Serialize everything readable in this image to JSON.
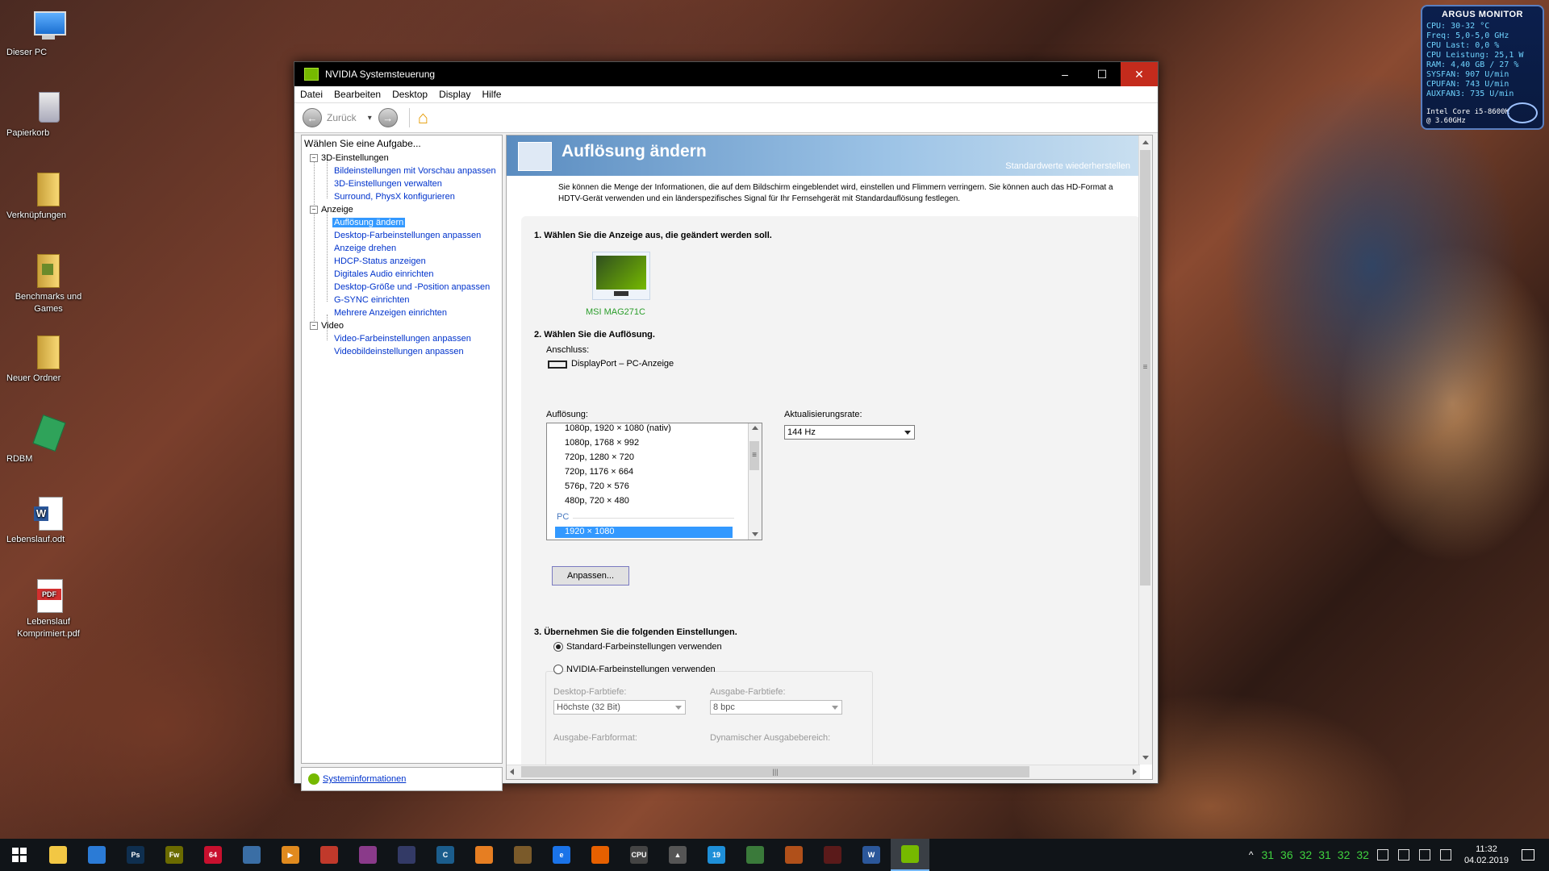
{
  "desktop": {
    "icons": [
      {
        "label": "Dieser PC"
      },
      {
        "label": "Papierkorb"
      },
      {
        "label": "Verknüpfungen"
      },
      {
        "label": "Benchmarks und Games"
      },
      {
        "label": "Neuer Ordner"
      },
      {
        "label": "RDBM"
      },
      {
        "label": "Lebenslauf.odt"
      },
      {
        "label": "Lebenslauf Komprimiert.pdf"
      }
    ],
    "pdf_badge": "PDF"
  },
  "argus": {
    "title": "ARGUS MONITOR",
    "lines": [
      "CPU: 30-32 °C",
      "Freq: 5,0-5,0 GHz",
      "CPU Last: 0,0 %",
      "CPU Leistung: 25,1 W",
      "RAM: 4,40 GB / 27 %",
      "SYSFAN: 907 U/min",
      "CPUFAN: 743 U/min",
      "AUXFAN3: 735 U/min"
    ],
    "footer1": "Intel Core i5-8600K",
    "footer2": "@ 3.60GHz"
  },
  "window": {
    "title": "NVIDIA Systemsteuerung",
    "controls": {
      "minimize": "‒",
      "maximize": "☐",
      "close": "✕"
    },
    "menu": [
      "Datei",
      "Bearbeiten",
      "Desktop",
      "Display",
      "Hilfe"
    ],
    "toolbar": {
      "back_label": "Zurück",
      "back_glyph": "←",
      "fwd_glyph": "→",
      "home_glyph": "⌂",
      "dropdown_glyph": "▾"
    },
    "left": {
      "header": "Wählen Sie eine Aufgabe...",
      "categories": [
        {
          "label": "3D-Einstellungen",
          "items": [
            "Bildeinstellungen mit Vorschau anpassen",
            "3D-Einstellungen verwalten",
            "Surround, PhysX konfigurieren"
          ]
        },
        {
          "label": "Anzeige",
          "items": [
            "Auflösung ändern",
            "Desktop-Farbeinstellungen anpassen",
            "Anzeige drehen",
            "HDCP-Status anzeigen",
            "Digitales Audio einrichten",
            "Desktop-Größe und -Position anpassen",
            "G-SYNC einrichten",
            "Mehrere Anzeigen einrichten"
          ]
        },
        {
          "label": "Video",
          "items": [
            "Video-Farbeinstellungen anpassen",
            "Videobildeinstellungen anpassen"
          ]
        }
      ],
      "expander": "−",
      "sysinfo": "Systeminformationen"
    },
    "main": {
      "title": "Auflösung ändern",
      "restore": "Standardwerte wiederherstellen",
      "description": "Sie können die Menge der Informationen, die auf dem Bildschirm eingeblendet wird, einstellen und Flimmern verringern. Sie können auch das HD-Format a HDTV-Gerät verwenden und ein länderspezifisches Signal für Ihr Fernsehgerät mit Standardauflösung festlegen.",
      "step1": "1. Wählen Sie die Anzeige aus, die geändert werden soll.",
      "monitor_name": "MSI MAG271C",
      "step2": "2. Wählen Sie die Auflösung.",
      "connection_label": "Anschluss:",
      "connection_value": "DisplayPort – PC-Anzeige",
      "resolution_label": "Auflösung:",
      "resolutions": [
        "1080p, 1920 × 1080 (nativ)",
        "1080p, 1768 × 992",
        "720p, 1280 × 720",
        "720p, 1176 × 664",
        "576p, 720 × 576",
        "480p, 720 × 480"
      ],
      "pc_group": "PC",
      "selected_resolution": "1920 × 1080",
      "refresh_label": "Aktualisierungsrate:",
      "refresh_value": "144 Hz",
      "customize_button": "Anpassen...",
      "step3": "3. Übernehmen Sie die folgenden Einstellungen.",
      "radio_default": "Standard-Farbeinstellungen verwenden",
      "radio_nvidia": "NVIDIA-Farbeinstellungen verwenden",
      "desktop_depth_label": "Desktop-Farbtiefe:",
      "desktop_depth_value": "Höchste (32 Bit)",
      "output_depth_label": "Ausgabe-Farbtiefe:",
      "output_depth_value": "8 bpc",
      "output_format_label": "Ausgabe-Farbformat:",
      "dynamic_range_label": "Dynamischer Ausgabebereich:",
      "scroll_grip": "≡",
      "hscroll_grip": "|||"
    }
  },
  "taskbar": {
    "apps": [
      {
        "name": "explorer",
        "color": "#f2c744",
        "text": ""
      },
      {
        "name": "app-blue",
        "color": "#2b7bd6",
        "text": ""
      },
      {
        "name": "photoshop",
        "color": "#0f2f4f",
        "text": "Ps"
      },
      {
        "name": "fireworks",
        "color": "#6b6b00",
        "text": "Fw"
      },
      {
        "name": "aida64",
        "color": "#c8102e",
        "text": "64"
      },
      {
        "name": "app-calc",
        "color": "#3a6ea5",
        "text": ""
      },
      {
        "name": "player",
        "color": "#e08a1e",
        "text": "▶"
      },
      {
        "name": "app-red",
        "color": "#c0392b",
        "text": ""
      },
      {
        "name": "winrar",
        "color": "#8a3a8a",
        "text": ""
      },
      {
        "name": "cinema",
        "color": "#333a66",
        "text": ""
      },
      {
        "name": "app-c",
        "color": "#1b5d8c",
        "text": "C"
      },
      {
        "name": "app-orange",
        "color": "#e67e22",
        "text": ""
      },
      {
        "name": "app-doc",
        "color": "#7a5a2a",
        "text": ""
      },
      {
        "name": "edge",
        "color": "#1a73e8",
        "text": "e"
      },
      {
        "name": "firefox",
        "color": "#e66000",
        "text": ""
      },
      {
        "name": "cpu-z",
        "color": "#444",
        "text": "CPU"
      },
      {
        "name": "app-tri",
        "color": "#555",
        "text": "▲"
      },
      {
        "name": "app-19",
        "color": "#1e8fd8",
        "text": "19"
      },
      {
        "name": "app-green",
        "color": "#3a7a3a",
        "text": ""
      },
      {
        "name": "app-game",
        "color": "#b0501a",
        "text": ""
      },
      {
        "name": "app-dark",
        "color": "#5a1a1a",
        "text": ""
      },
      {
        "name": "word",
        "color": "#2b579a",
        "text": "W"
      },
      {
        "name": "nvidia",
        "color": "#76b900",
        "text": "",
        "active": true
      }
    ],
    "temps": [
      "31",
      "36",
      "32",
      "31",
      "32",
      "32"
    ],
    "tray_chevron": "^",
    "time": "11:32",
    "date": "04.02.2019"
  }
}
